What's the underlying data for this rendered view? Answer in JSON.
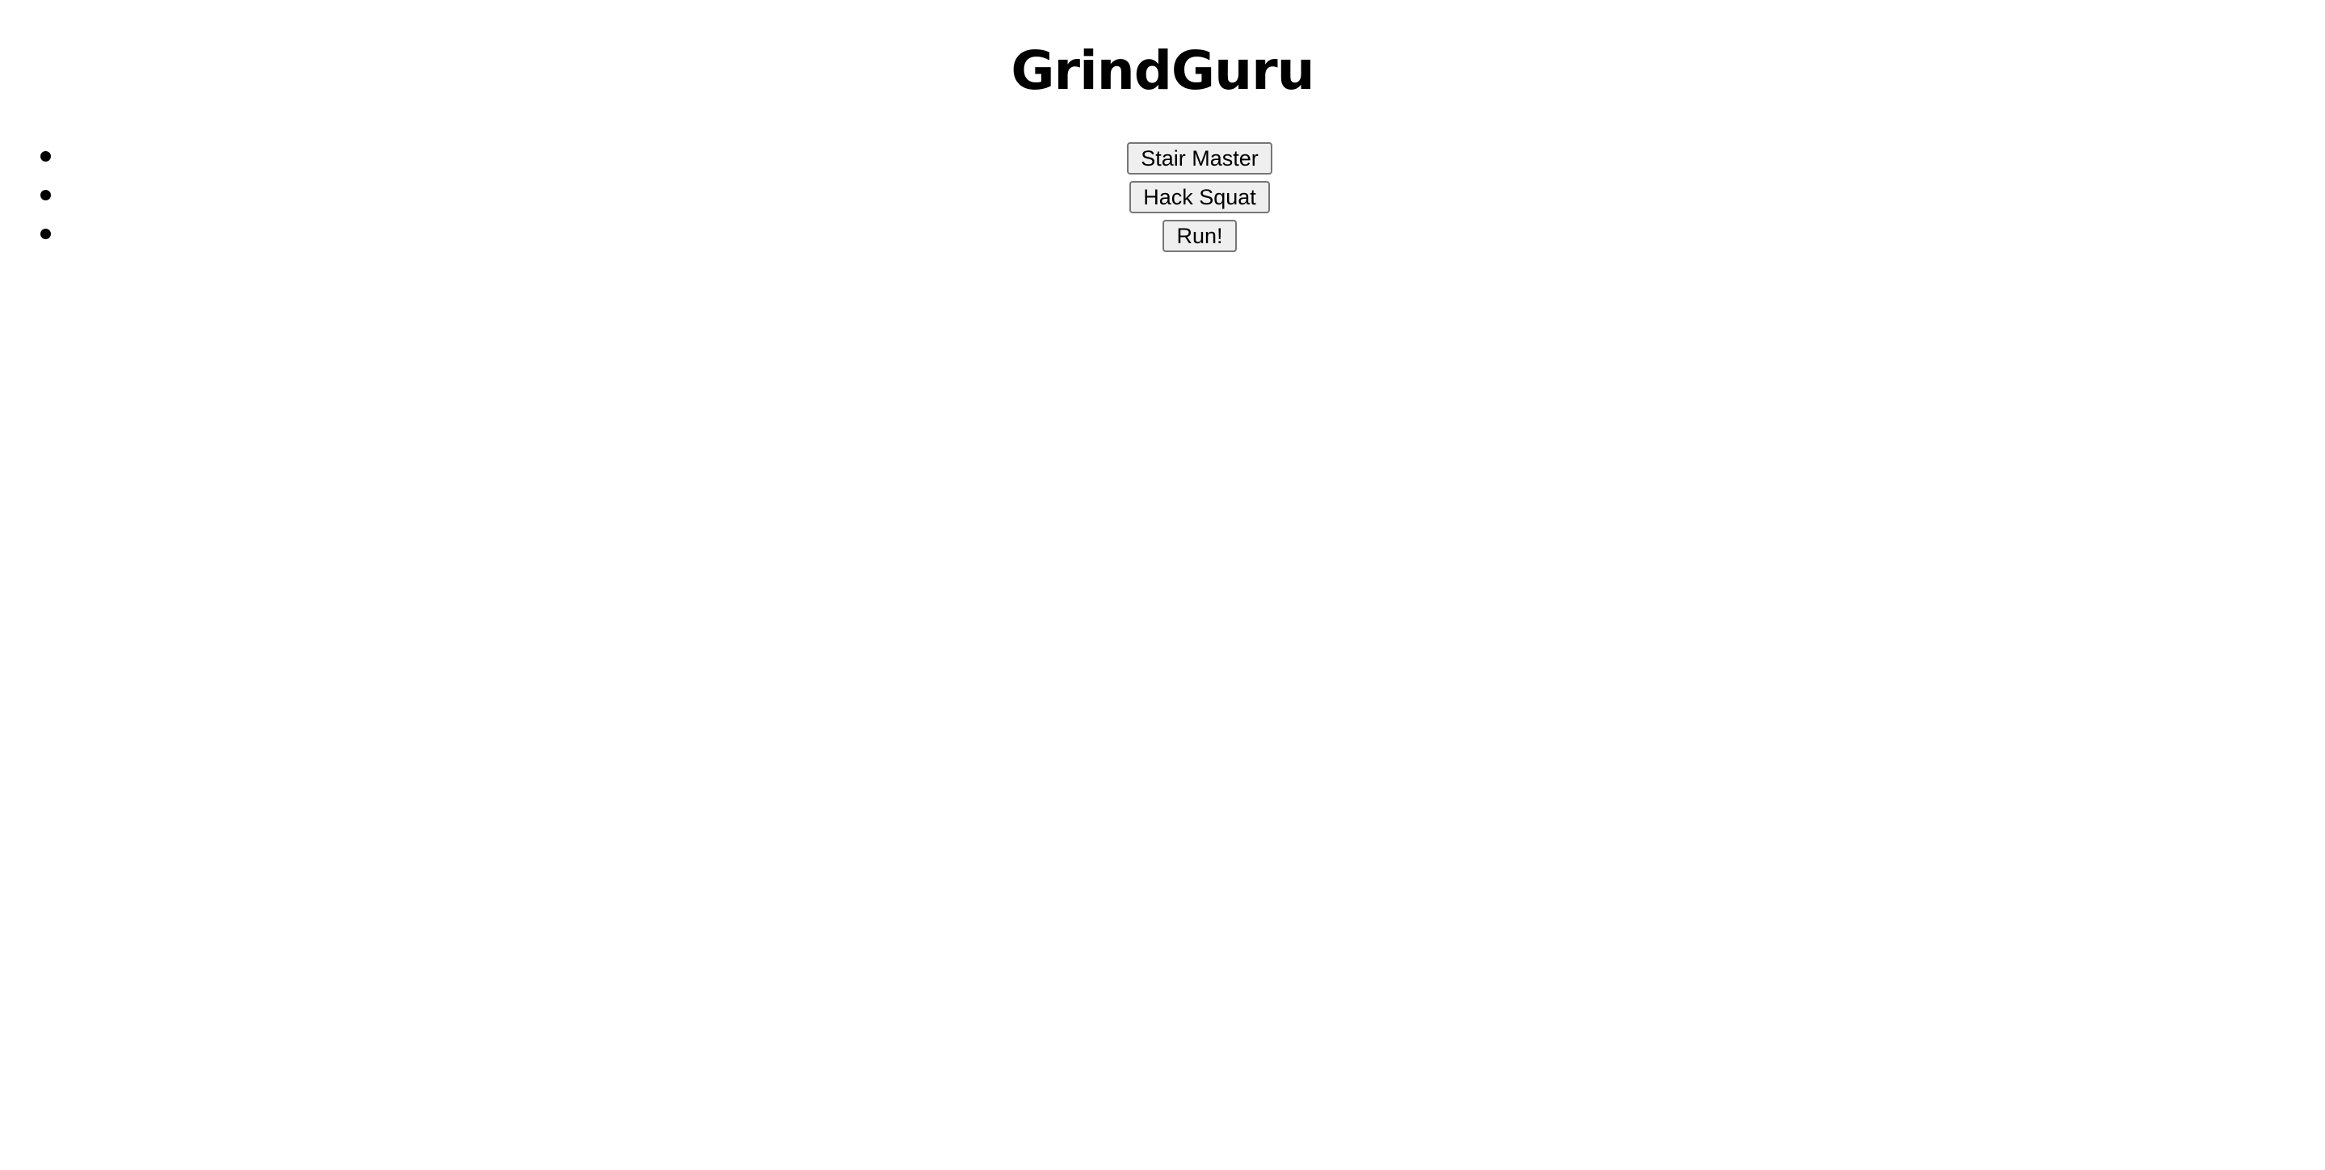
{
  "app": {
    "title": "GrindGuru"
  },
  "exercises": {
    "items": [
      {
        "label": "Stair Master"
      },
      {
        "label": "Hack Squat"
      },
      {
        "label": "Run!"
      }
    ]
  }
}
